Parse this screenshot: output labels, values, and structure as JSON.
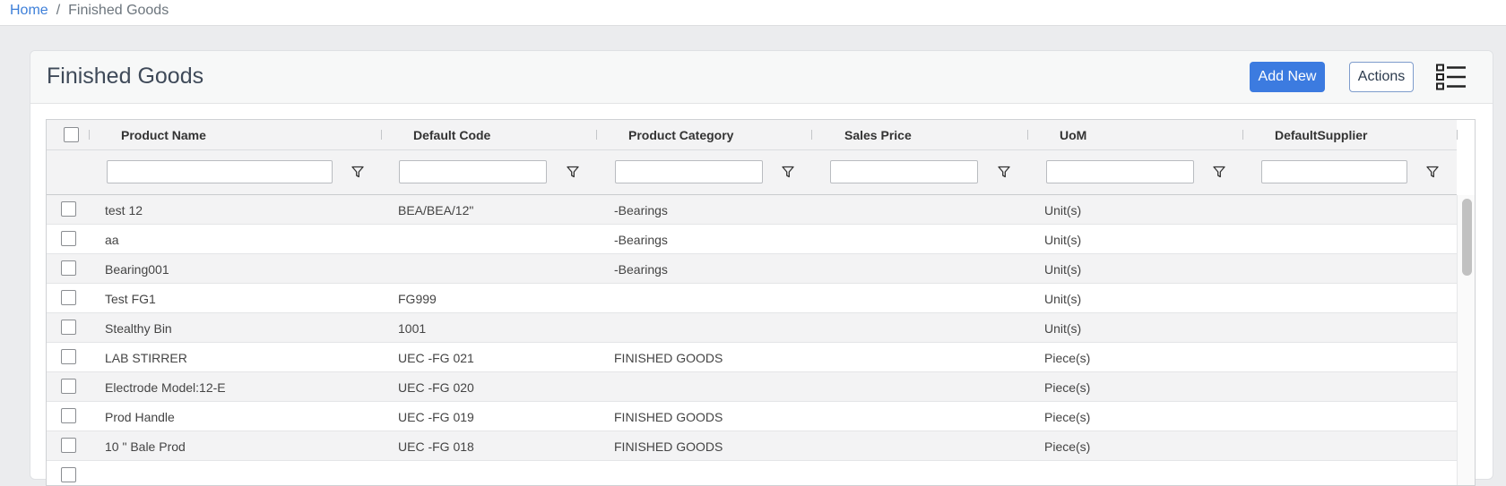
{
  "breadcrumb": {
    "home": "Home",
    "separator": "/",
    "current": "Finished Goods"
  },
  "header": {
    "title": "Finished Goods",
    "add_new": "Add New",
    "actions": "Actions",
    "view_icon": "list-view-icon"
  },
  "columns": {
    "product_name": "Product Name",
    "default_code": "Default Code",
    "product_category": "Product Category",
    "sales_price": "Sales Price",
    "uom": "UoM",
    "default_supplier": "DefaultSupplier"
  },
  "filters": {
    "icon": "filter-icon",
    "placeholder": ""
  },
  "rows": [
    {
      "name": "test 12",
      "code": "BEA/BEA/12\"",
      "category": "-Bearings",
      "price": "",
      "uom": "Unit(s)",
      "supplier": ""
    },
    {
      "name": "aa",
      "code": "",
      "category": "-Bearings",
      "price": "",
      "uom": "Unit(s)",
      "supplier": ""
    },
    {
      "name": "Bearing001",
      "code": "",
      "category": "-Bearings",
      "price": "",
      "uom": "Unit(s)",
      "supplier": ""
    },
    {
      "name": "Test FG1",
      "code": "FG999",
      "category": "",
      "price": "",
      "uom": "Unit(s)",
      "supplier": ""
    },
    {
      "name": "Stealthy Bin",
      "code": "1001",
      "category": "",
      "price": "",
      "uom": "Unit(s)",
      "supplier": ""
    },
    {
      "name": "LAB STIRRER",
      "code": "UEC -FG 021",
      "category": "FINISHED GOODS",
      "price": "",
      "uom": "Piece(s)",
      "supplier": ""
    },
    {
      "name": "Electrode Model:12-E",
      "code": "UEC -FG 020",
      "category": "",
      "price": "",
      "uom": "Piece(s)",
      "supplier": ""
    },
    {
      "name": "Prod Handle",
      "code": "UEC -FG 019",
      "category": "FINISHED GOODS",
      "price": "",
      "uom": "Piece(s)",
      "supplier": ""
    },
    {
      "name": "10 \" Bale Prod",
      "code": "UEC -FG 018",
      "category": "FINISHED GOODS",
      "price": "",
      "uom": "Piece(s)",
      "supplier": ""
    },
    {
      "name": "",
      "code": "",
      "category": "",
      "price": "",
      "uom": "",
      "supplier": ""
    }
  ],
  "colors": {
    "accent": "#3c7be0",
    "link": "#3d7fd9",
    "title": "#3f4a59"
  }
}
